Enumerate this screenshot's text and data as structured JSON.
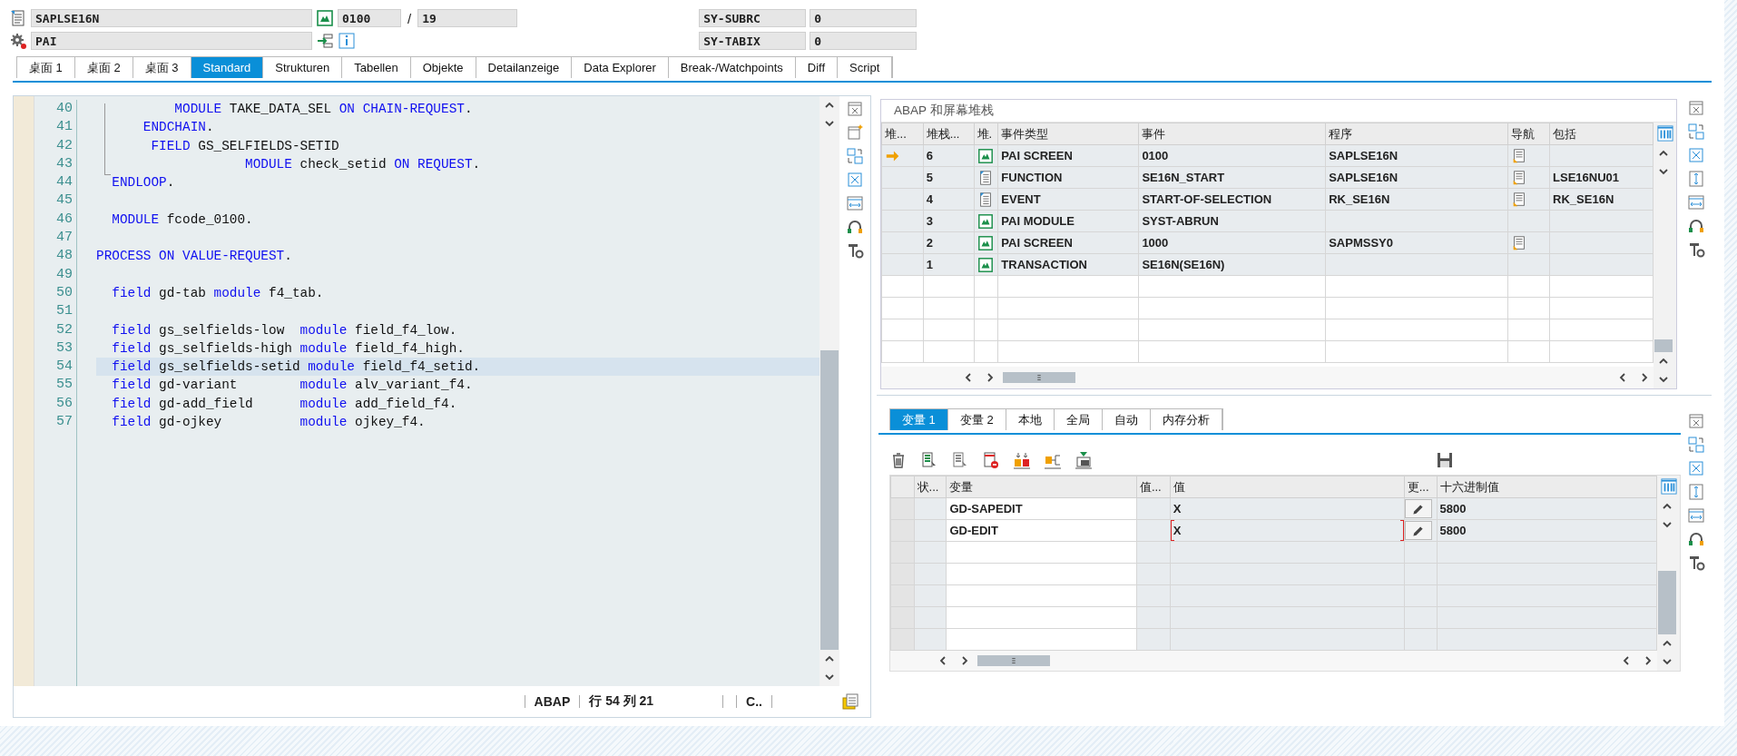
{
  "header": {
    "program": "SAPLSE16N",
    "event": "PAI",
    "screen": "0100",
    "separator": "/",
    "line": "19",
    "sysfields": [
      {
        "name": "SY-SUBRC",
        "value": "0"
      },
      {
        "name": "SY-TABIX",
        "value": "0"
      }
    ]
  },
  "tabs": [
    {
      "label": "桌面 1",
      "selected": false
    },
    {
      "label": "桌面 2",
      "selected": false
    },
    {
      "label": "桌面 3",
      "selected": false
    },
    {
      "label": "Standard",
      "selected": true
    },
    {
      "label": "Strukturen",
      "selected": false
    },
    {
      "label": "Tabellen",
      "selected": false
    },
    {
      "label": "Objekte",
      "selected": false
    },
    {
      "label": "Detailanzeige",
      "selected": false
    },
    {
      "label": "Data Explorer",
      "selected": false
    },
    {
      "label": "Break-/Watchpoints",
      "selected": false
    },
    {
      "label": "Diff",
      "selected": false
    },
    {
      "label": "Script",
      "selected": false
    }
  ],
  "source": {
    "lines": [
      {
        "number": "40",
        "selected": false,
        "tokens": [
          {
            "kind": "keyword",
            "text": "          MODULE"
          },
          {
            "kind": "text",
            "text": " TAKE_DATA_SEL "
          },
          {
            "kind": "keyword",
            "text": "ON CHAIN-REQUEST"
          },
          {
            "kind": "text",
            "text": "."
          }
        ]
      },
      {
        "number": "41",
        "selected": false,
        "tokens": [
          {
            "kind": "keyword",
            "text": "      ENDCHAIN"
          },
          {
            "kind": "text",
            "text": "."
          }
        ]
      },
      {
        "number": "42",
        "selected": false,
        "tokens": [
          {
            "kind": "keyword",
            "text": "       FIELD"
          },
          {
            "kind": "text",
            "text": " GS_SELFIELDS-SETID"
          }
        ]
      },
      {
        "number": "43",
        "selected": false,
        "tokens": [
          {
            "kind": "keyword",
            "text": "                   MODULE"
          },
          {
            "kind": "text",
            "text": " check_setid "
          },
          {
            "kind": "keyword",
            "text": "ON REQUEST"
          },
          {
            "kind": "text",
            "text": "."
          }
        ]
      },
      {
        "number": "44",
        "selected": false,
        "tokens": [
          {
            "kind": "keyword",
            "text": "  ENDLOOP"
          },
          {
            "kind": "text",
            "text": "."
          }
        ]
      },
      {
        "number": "45",
        "selected": false
      },
      {
        "number": "46",
        "selected": false,
        "tokens": [
          {
            "kind": "keyword",
            "text": "  MODULE"
          },
          {
            "kind": "text",
            "text": " fcode_0100."
          }
        ]
      },
      {
        "number": "47",
        "selected": false
      },
      {
        "number": "48",
        "selected": false,
        "tokens": [
          {
            "kind": "keyword",
            "text": "PROCESS ON VALUE-REQUEST"
          },
          {
            "kind": "text",
            "text": "."
          }
        ]
      },
      {
        "number": "49",
        "selected": false
      },
      {
        "number": "50",
        "selected": false,
        "tokens": [
          {
            "kind": "keyword",
            "text": "  field"
          },
          {
            "kind": "text",
            "text": " gd-tab "
          },
          {
            "kind": "keyword",
            "text": "module"
          },
          {
            "kind": "text",
            "text": " f4_tab."
          }
        ]
      },
      {
        "number": "51",
        "selected": false
      },
      {
        "number": "52",
        "selected": false,
        "tokens": [
          {
            "kind": "keyword",
            "text": "  field"
          },
          {
            "kind": "text",
            "text": " gs_selfields-low  "
          },
          {
            "kind": "keyword",
            "text": "module"
          },
          {
            "kind": "text",
            "text": " field_f4_low."
          }
        ]
      },
      {
        "number": "53",
        "selected": false,
        "tokens": [
          {
            "kind": "keyword",
            "text": "  field"
          },
          {
            "kind": "text",
            "text": " gs_selfields-high "
          },
          {
            "kind": "keyword",
            "text": "module"
          },
          {
            "kind": "text",
            "text": " field_f4_high."
          }
        ]
      },
      {
        "number": "54",
        "selected": true,
        "tokens": [
          {
            "kind": "keyword",
            "text": "  field"
          },
          {
            "kind": "text",
            "text": " gs_selfields-setid "
          },
          {
            "kind": "keyword",
            "text": "module"
          },
          {
            "kind": "text",
            "text": " field_f4_setid."
          }
        ]
      },
      {
        "number": "55",
        "selected": false,
        "tokens": [
          {
            "kind": "keyword",
            "text": "  field"
          },
          {
            "kind": "text",
            "text": " gd-variant        "
          },
          {
            "kind": "keyword",
            "text": "module"
          },
          {
            "kind": "text",
            "text": " alv_variant_f4."
          }
        ]
      },
      {
        "number": "56",
        "selected": false,
        "tokens": [
          {
            "kind": "keyword",
            "text": "  field"
          },
          {
            "kind": "text",
            "text": " gd-add_field      "
          },
          {
            "kind": "keyword",
            "text": "module"
          },
          {
            "kind": "text",
            "text": " add_field_f4."
          }
        ]
      },
      {
        "number": "57",
        "selected": false,
        "tokens": [
          {
            "kind": "keyword",
            "text": "  field"
          },
          {
            "kind": "text",
            "text": " gd-ojkey          "
          },
          {
            "kind": "keyword",
            "text": "module"
          },
          {
            "kind": "text",
            "text": " ojkey_f4."
          }
        ]
      }
    ],
    "status": {
      "language": "ABAP",
      "position": "行 54 列 21",
      "mode": "C.."
    }
  },
  "stack": {
    "title": "ABAP 和屏幕堆栈",
    "columns": [
      "堆...",
      "堆栈...",
      "堆.",
      "事件类型",
      "事件",
      "程序",
      "导航",
      "包括"
    ],
    "rows": [
      {
        "current": true,
        "level": "6",
        "kind": "screen",
        "event_type": "PAI SCREEN",
        "event": "0100",
        "program": "SAPLSE16N",
        "navigable": true
      },
      {
        "current": false,
        "level": "5",
        "kind": "program",
        "event_type": "FUNCTION",
        "event": "SE16N_START",
        "program": "SAPLSE16N",
        "navigable": true,
        "include": "LSE16NU01"
      },
      {
        "current": false,
        "level": "4",
        "kind": "program",
        "event_type": "EVENT",
        "event": "START-OF-SELECTION",
        "program": "RK_SE16N",
        "navigable": true,
        "include": "RK_SE16N"
      },
      {
        "current": false,
        "level": "3",
        "kind": "screen",
        "event_type": "PAI MODULE",
        "event": "SYST-ABRUN",
        "navigable": false
      },
      {
        "current": false,
        "level": "2",
        "kind": "screen",
        "event_type": "PAI SCREEN",
        "event": "1000",
        "program": "SAPMSSY0",
        "navigable": true
      },
      {
        "current": false,
        "level": "1",
        "kind": "screen",
        "event_type": "TRANSACTION",
        "event": "SE16N(SE16N)",
        "navigable": false
      }
    ]
  },
  "variables": {
    "tabs": [
      {
        "label": "变量 1",
        "selected": true
      },
      {
        "label": "变量 2",
        "selected": false
      },
      {
        "label": "本地",
        "selected": false
      },
      {
        "label": "全局",
        "selected": false
      },
      {
        "label": "自动",
        "selected": false
      },
      {
        "label": "内存分析",
        "selected": false
      }
    ],
    "columns": [
      "状...",
      "变量",
      "值...",
      "值",
      "更...",
      "十六进制值"
    ],
    "rows": [
      {
        "variable": "GD-SAPEDIT",
        "value": "X",
        "hex": "5800",
        "focused": false
      },
      {
        "variable": "GD-EDIT",
        "value": "X",
        "hex": "5800",
        "focused": true
      }
    ]
  }
}
